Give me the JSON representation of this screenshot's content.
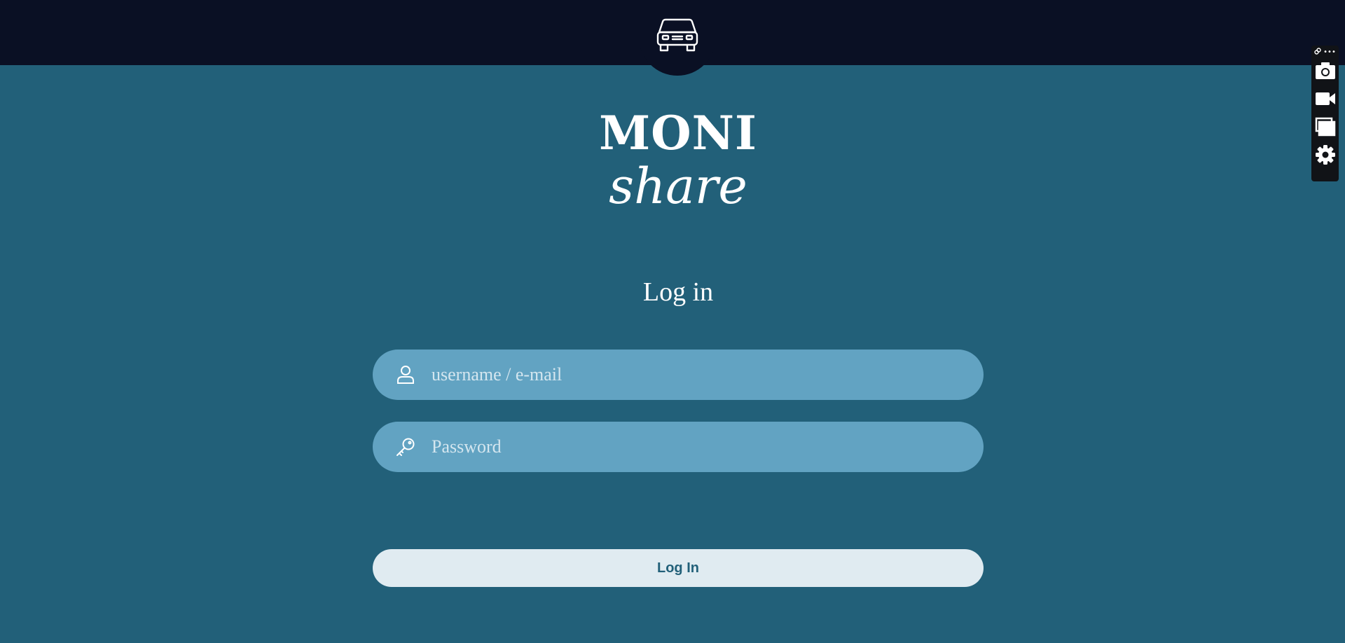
{
  "header": {
    "logo_icon": "car-icon"
  },
  "brand": {
    "name_top": "MONI",
    "name_bottom": "share"
  },
  "login": {
    "heading": "Log in",
    "username": {
      "placeholder": "username / e-mail",
      "icon": "user-icon",
      "value": ""
    },
    "password": {
      "placeholder": "Password",
      "icon": "key-icon",
      "value": ""
    },
    "submit_label": "Log In"
  },
  "side_toolbar": {
    "top_icons": [
      "link-icon",
      "more-icon"
    ],
    "more_label": "•••",
    "buttons": [
      "camera-icon",
      "video-camera-icon",
      "windows-icon",
      "gear-icon"
    ]
  },
  "colors": {
    "page_background": "#226079",
    "header_background": "#0a1024",
    "input_background": "#62a3c2",
    "button_background": "#e0ebf1",
    "button_text": "#226079"
  }
}
